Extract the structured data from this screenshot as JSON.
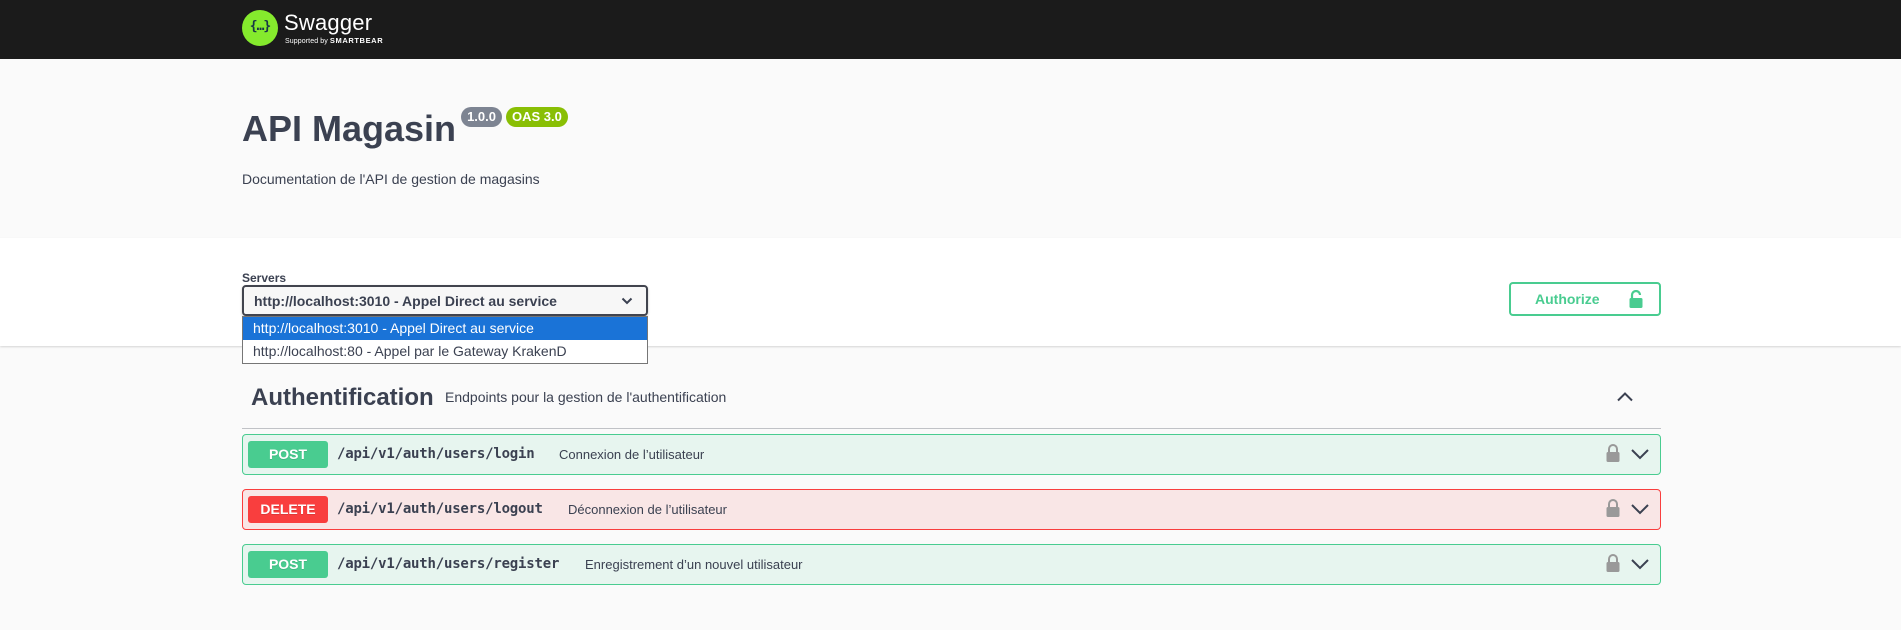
{
  "topbar": {
    "logo_glyph": "{…}",
    "logo_name": "Swagger",
    "logo_sub_prefix": "Supported by",
    "logo_sub_brand": "SMARTBEAR"
  },
  "info": {
    "title": "API Magasin",
    "version": "1.0.0",
    "oas": "OAS 3.0",
    "description": "Documentation de l'API de gestion de magasins"
  },
  "servers": {
    "label": "Servers",
    "selected": "http://localhost:3010 - Appel Direct au service",
    "options": [
      "http://localhost:3010 - Appel Direct au service",
      "http://localhost:80 - Appel par le Gateway KrakenD"
    ]
  },
  "authorize": {
    "label": "Authorize"
  },
  "tag": {
    "name": "Authentification",
    "description": "Endpoints pour la gestion de l'authentification"
  },
  "operations": [
    {
      "method": "POST",
      "path": "/api/v1/auth/users/login",
      "summary": "Connexion de l’utilisateur"
    },
    {
      "method": "DELETE",
      "path": "/api/v1/auth/users/logout",
      "summary": "Déconnexion de l’utilisateur"
    },
    {
      "method": "POST",
      "path": "/api/v1/auth/users/register",
      "summary": "Enregistrement d’un nouvel utilisateur"
    }
  ],
  "colors": {
    "topbar": "#1b1b1b",
    "post": "#49cc90",
    "delete": "#f93e3e",
    "badge_version": "#7d8492",
    "badge_oas": "#89bf04",
    "select_highlight": "#1a73d7"
  },
  "icons": {
    "logo": "swagger-logo-icon",
    "select": "chevron-down-icon",
    "authorize": "unlocked-icon",
    "tag_toggle": "chevron-up-icon",
    "operation_lock": "lock-icon",
    "operation_expand": "chevron-down-icon"
  }
}
